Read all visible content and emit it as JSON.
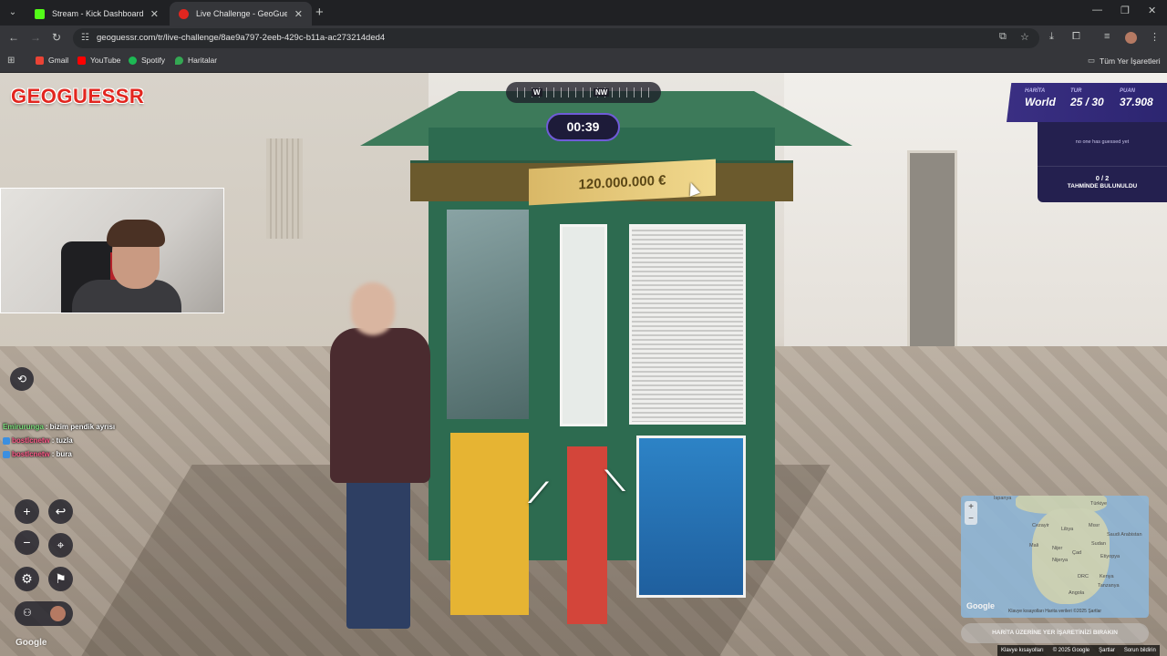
{
  "browser": {
    "tabs": [
      {
        "title": "Stream - Kick Dashboard",
        "favicon_color": "#53fc18",
        "active": false
      },
      {
        "title": "Live Challenge - GeoGuessr",
        "favicon_color": "#e2261f",
        "active": true
      }
    ],
    "url": "geoguessr.com/tr/live-challenge/8ae9a797-2eeb-429c-b11a-ac273214ded4",
    "bookmarks": [
      {
        "label": "Gmail",
        "color": "#ea4335"
      },
      {
        "label": "YouTube",
        "color": "#ff0000"
      },
      {
        "label": "Spotify",
        "color": "#1db954"
      },
      {
        "label": "Haritalar",
        "color": "#34a853"
      }
    ],
    "all_bookmarks_label": "Tüm Yer İşaretleri"
  },
  "game": {
    "logo": "GEOGUESSR",
    "compass": {
      "left_dir": "W",
      "right_dir": "NW"
    },
    "timer": "00:39",
    "stats": {
      "map_label": "HARİTA",
      "map_value": "World",
      "round_label": "TUR",
      "round_value": "25 / 30",
      "score_label": "PUAN",
      "score_value": "37.908"
    },
    "side_panel": {
      "no_guess_text": "no one has guessed yet",
      "count": "0 / 2",
      "found_text": "TAHMİNDE BULUNULDU"
    },
    "scene_sign": "120.000.000 €",
    "chat": [
      {
        "user": "Emirurunga",
        "user_color": "#7ee07e",
        "message": "bizim pendik ayrısı"
      },
      {
        "user": "bostlcnetw",
        "user_color": "#ff5b8a",
        "message": "tuzla"
      },
      {
        "user": "bostlcnetw",
        "user_color": "#ff5b8a",
        "message": "bura"
      }
    ],
    "controls": {
      "zoom_in": "+",
      "zoom_out": "−",
      "undo": "↩",
      "checkpoint": "⌖",
      "settings": "⚙",
      "flag": "⚑",
      "camera_toggle": "⟲"
    },
    "google_label": "Google",
    "minimap": {
      "labels": [
        "İspanya",
        "Türkiye",
        "Cezayir",
        "Libya",
        "Mısır",
        "Mali",
        "Nijer",
        "Çad",
        "Sudan",
        "Saudi Arabistan",
        "Nijerya",
        "Etiyopya",
        "Kenya",
        "DRC",
        "Tanzanya",
        "Angola"
      ],
      "google": "Google",
      "footer": "Klavye kısayolları  Harita verileri ©2025  Şartlar"
    },
    "guess_button": "HARİTA ÜZERİNE YER İŞARETİNİZİ BIRAKIN",
    "footer": [
      "Klavye kısayolları",
      "© 2025 Google",
      "Şartlar",
      "Sorun bildirin"
    ]
  }
}
